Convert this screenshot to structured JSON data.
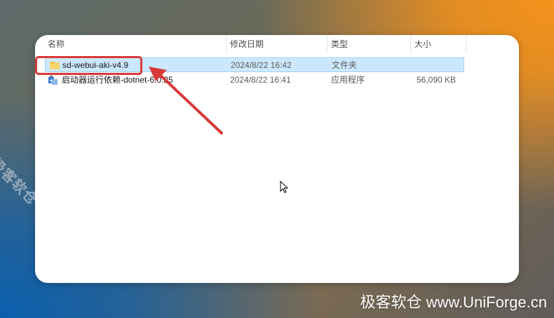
{
  "columns": {
    "name": "名称",
    "modified": "修改日期",
    "type": "类型",
    "size": "大小"
  },
  "files": [
    {
      "name": "sd-webui-aki-v4.9",
      "modified": "2024/8/22 16:42",
      "type": "文件夹",
      "size": "",
      "icon": "folder-icon",
      "selected": true
    },
    {
      "name": "启动器运行依赖-dotnet-6.0.25",
      "modified": "2024/8/22 16:41",
      "type": "应用程序",
      "size": "56,090 KB",
      "icon": "installer-icon",
      "selected": false
    }
  ],
  "watermark": {
    "diagonal": "极客软仓 UniForge.cn",
    "corner": "极客软仓 www.UniForge.cn"
  },
  "colors": {
    "selection": "#cce8ff",
    "highlight": "#d83a3a",
    "folder": "#f4c542"
  }
}
